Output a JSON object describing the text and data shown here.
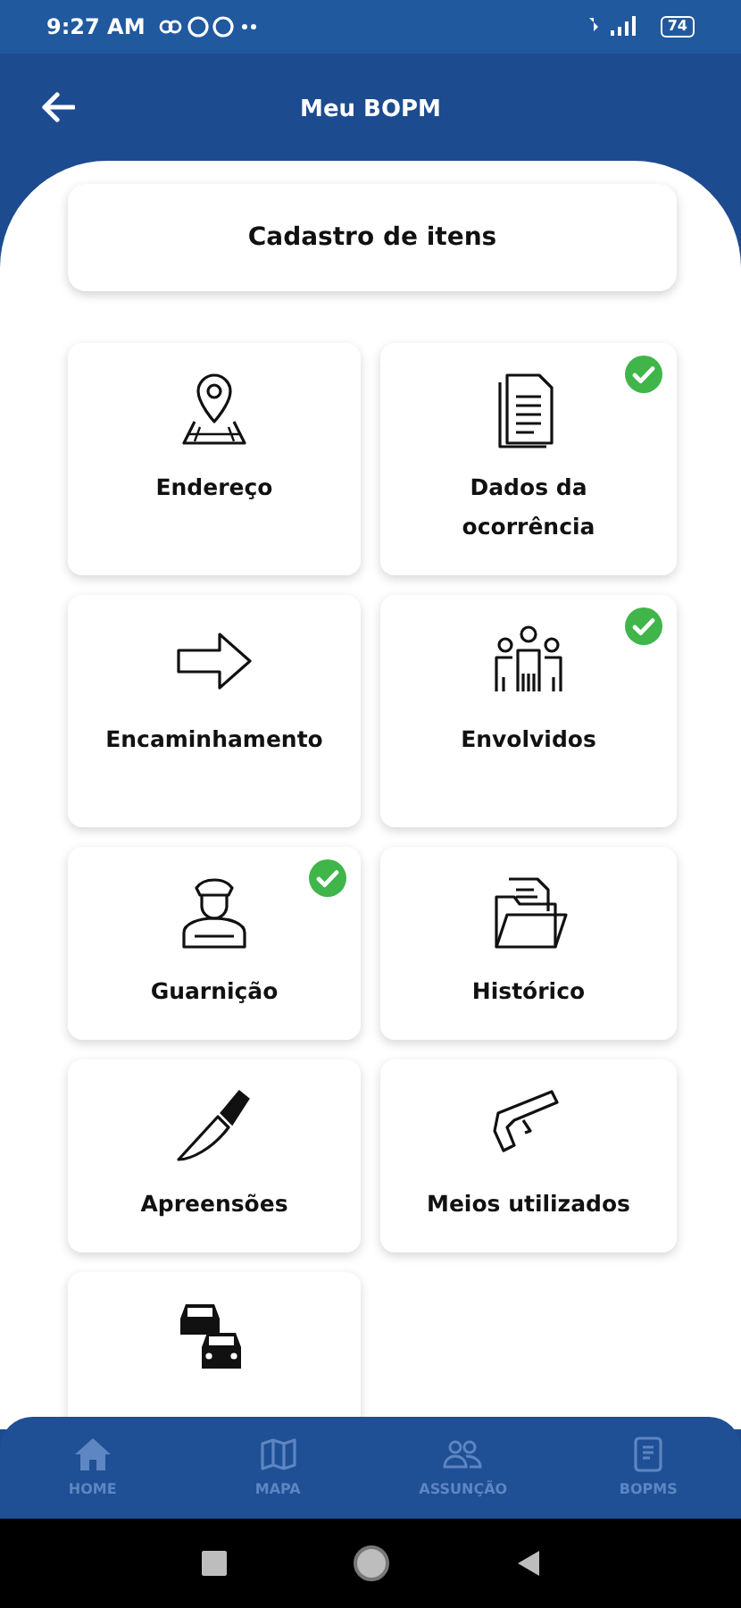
{
  "status_bar": {
    "time": "9:27 AM",
    "battery": "74"
  },
  "app_bar": {
    "title": "Meu BOPM"
  },
  "header_card": {
    "title": "Cadastro de itens"
  },
  "items": [
    {
      "label": "Endereço",
      "checked": false
    },
    {
      "label": "Dados da ocorrência",
      "checked": true
    },
    {
      "label": "Encaminhamento",
      "checked": false
    },
    {
      "label": "Envolvidos",
      "checked": true
    },
    {
      "label": "Guarnição",
      "checked": true
    },
    {
      "label": "Histórico",
      "checked": false
    },
    {
      "label": "Apreensões",
      "checked": false
    },
    {
      "label": "Meios utilizados",
      "checked": false
    },
    {
      "checked": false
    }
  ],
  "bottom_nav": [
    {
      "label": "HOME"
    },
    {
      "label": "MAPA"
    },
    {
      "label": "ASSUNÇÃO"
    },
    {
      "label": "BOPMS"
    }
  ]
}
